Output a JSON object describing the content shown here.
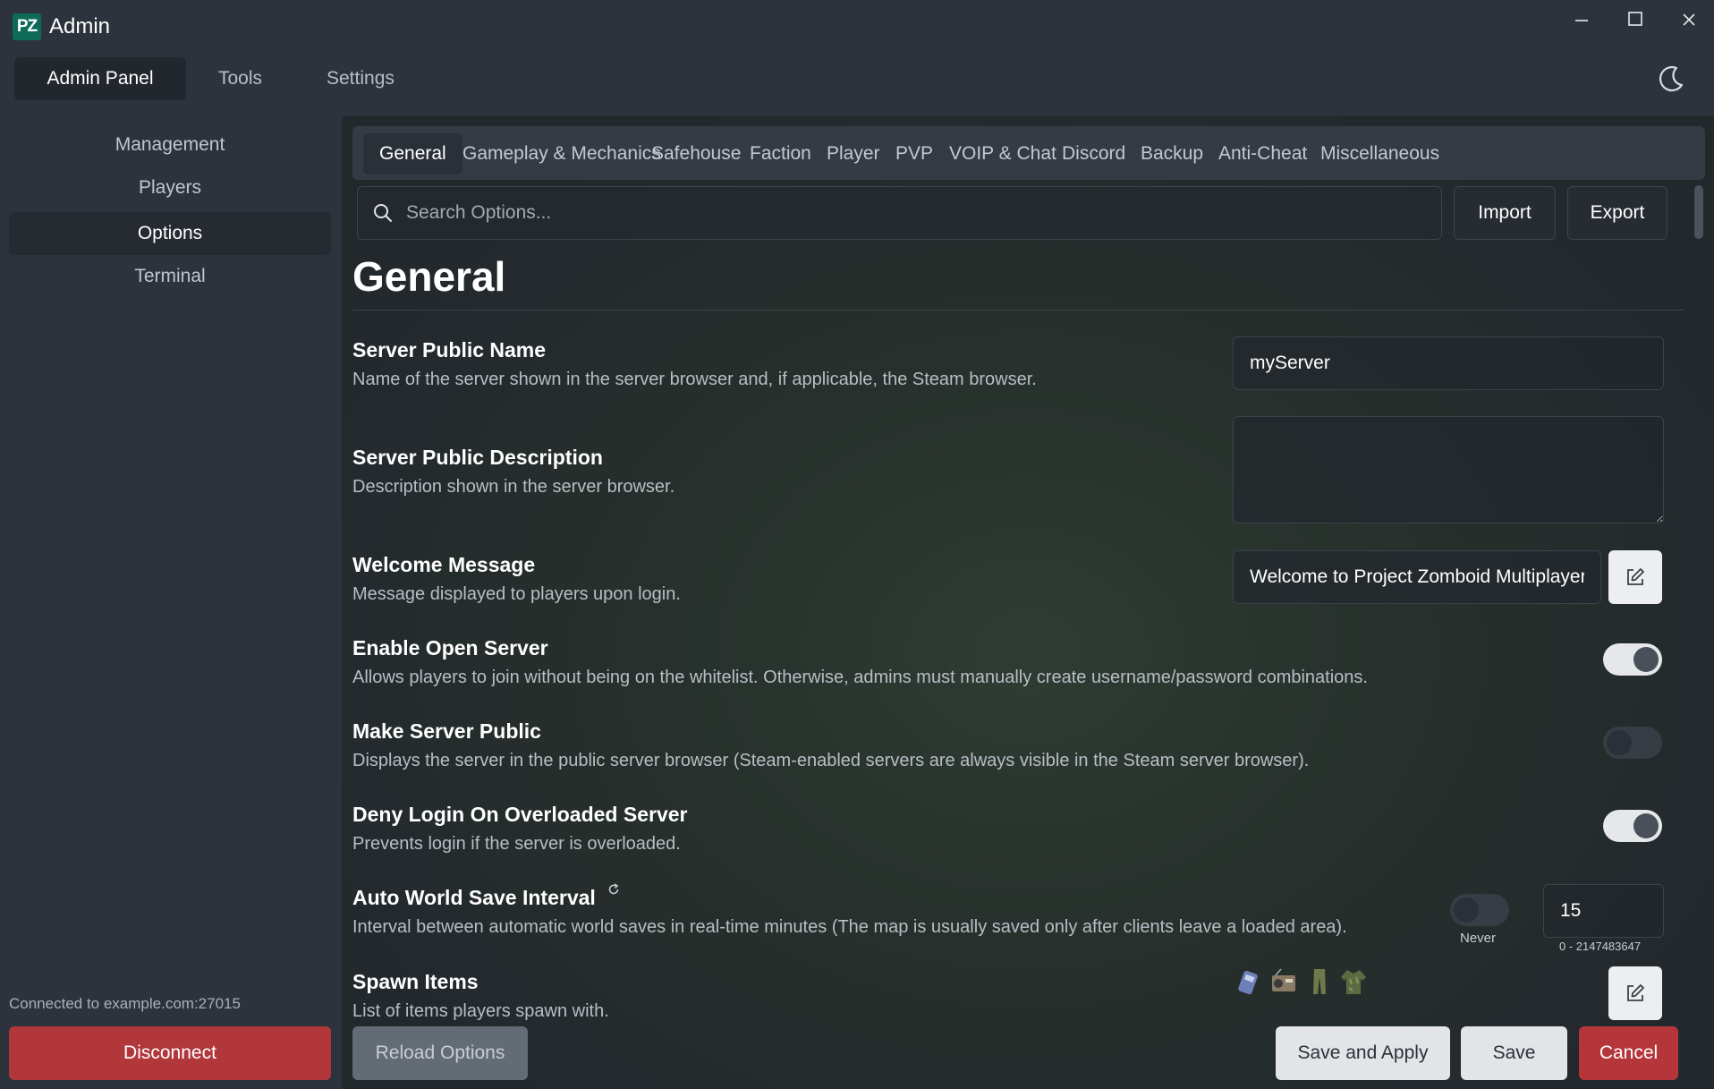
{
  "app": {
    "logo_text": "PZ",
    "title": "Admin"
  },
  "window_controls": {
    "minimize": "—",
    "maximize": "☐",
    "close": "✕"
  },
  "topnav": {
    "items": [
      "Admin Panel",
      "Tools",
      "Settings"
    ],
    "active": "Admin Panel"
  },
  "sidebar": {
    "items": [
      "Management",
      "Players",
      "Options",
      "Terminal"
    ],
    "active": "Options",
    "connection_status": "Connected to example.com:27015",
    "disconnect_label": "Disconnect"
  },
  "tabs": {
    "items": [
      "General",
      "Gameplay & Mechanics",
      "Safehouse",
      "Faction",
      "Player",
      "PVP",
      "VOIP & Chat",
      "Discord",
      "Backup",
      "Anti-Cheat",
      "Miscellaneous"
    ],
    "active": "General"
  },
  "search": {
    "placeholder": "Search Options...",
    "value": ""
  },
  "toolbar": {
    "import_label": "Import",
    "export_label": "Export"
  },
  "section_title": "General",
  "options": {
    "server_public_name": {
      "title": "Server Public Name",
      "desc": "Name of the server shown in the server browser and, if applicable, the Steam browser.",
      "value": "myServer"
    },
    "server_public_description": {
      "title": "Server Public Description",
      "desc": "Description shown in the server browser.",
      "value": ""
    },
    "welcome_message": {
      "title": "Welcome Message",
      "desc": "Message displayed to players upon login.",
      "value": "Welcome to Project Zomboid Multiplayer!"
    },
    "enable_open_server": {
      "title": "Enable Open Server",
      "desc": "Allows players to join without being on the whitelist. Otherwise, admins must manually create username/password combinations.",
      "enabled": true
    },
    "make_server_public": {
      "title": "Make Server Public",
      "desc": "Displays the server in the public server browser (Steam-enabled servers are always visible in the Steam server browser).",
      "enabled": false
    },
    "deny_login_overloaded": {
      "title": "Deny Login On Overloaded Server",
      "desc": "Prevents login if the server is overloaded.",
      "enabled": true
    },
    "auto_world_save_interval": {
      "title": "Auto World Save Interval",
      "desc": "Interval between automatic world saves in real-time minutes (The map is usually saved only after clients leave a loaded area).",
      "never_enabled": false,
      "never_label": "Never",
      "value": "15",
      "range": "0 - 2147483647"
    },
    "spawn_items": {
      "title": "Spawn Items",
      "desc": "List of items players spawn with.",
      "items": [
        "walkie-talkie-icon",
        "radio-icon",
        "pants-icon",
        "jacket-icon"
      ]
    }
  },
  "bottom_bar": {
    "reload_label": "Reload Options",
    "save_apply_label": "Save and Apply",
    "save_label": "Save",
    "cancel_label": "Cancel"
  }
}
